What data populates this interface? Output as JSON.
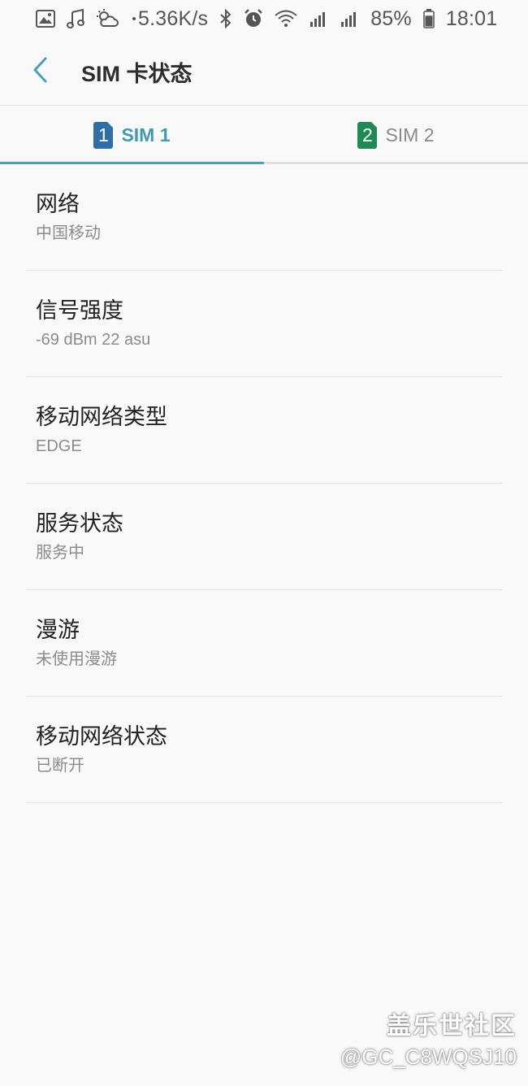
{
  "status_bar": {
    "left_icons": [
      "image-icon",
      "music-note-icon",
      "weather-icon",
      "dot-icon"
    ],
    "net_speed": "5.36K/s",
    "right_icons": [
      "bluetooth-icon",
      "alarm-icon",
      "wifi-icon",
      "signal-sim1-icon",
      "signal-sim2-icon"
    ],
    "battery_level": "85%",
    "battery_fraction": 0.85,
    "time": "18:01"
  },
  "header": {
    "back_icon": "chevron-left-icon",
    "title": "SIM 卡状态"
  },
  "tabs": [
    {
      "number": "1",
      "label": "SIM 1",
      "active": true,
      "badge_color": "#2f6fa8"
    },
    {
      "number": "2",
      "label": "SIM 2",
      "active": false,
      "badge_color": "#1f8a54"
    }
  ],
  "items": [
    {
      "title": "网络",
      "value": "中国移动"
    },
    {
      "title": "信号强度",
      "value": "-69 dBm 22 asu"
    },
    {
      "title": "移动网络类型",
      "value": "EDGE"
    },
    {
      "title": "服务状态",
      "value": "服务中"
    },
    {
      "title": "漫游",
      "value": "未使用漫游"
    },
    {
      "title": "移动网络状态",
      "value": "已断开"
    }
  ],
  "watermark": {
    "site": "盖乐世社区",
    "user": "@GC_C8WQSJ10"
  },
  "colors": {
    "accent": "#4a9fbb",
    "background": "#f9f9f9",
    "divider": "#e4e4e4"
  }
}
